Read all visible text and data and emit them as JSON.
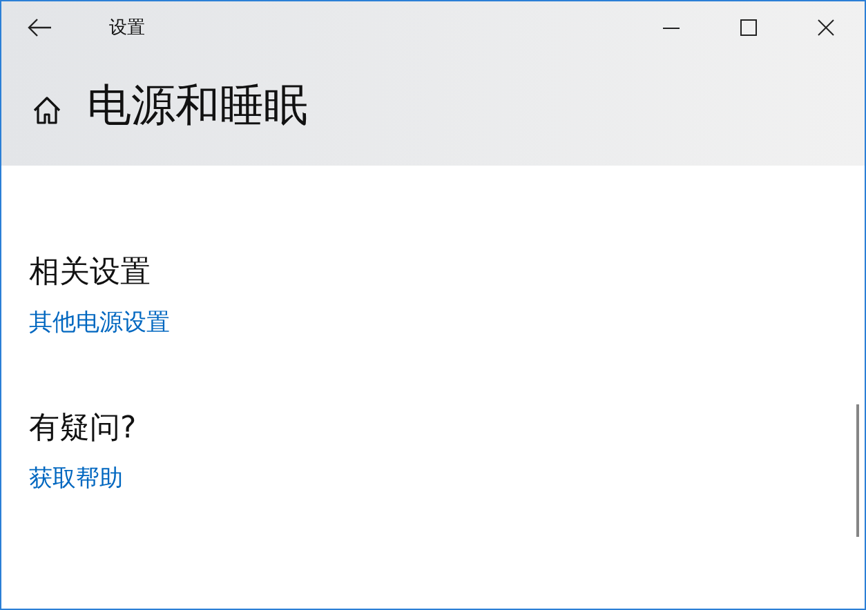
{
  "window": {
    "title": "设置"
  },
  "page": {
    "title": "电源和睡眠"
  },
  "sections": [
    {
      "heading": "相关设置",
      "links": [
        "其他电源设置"
      ]
    },
    {
      "heading": "有疑问?",
      "links": [
        "获取帮助"
      ]
    }
  ]
}
